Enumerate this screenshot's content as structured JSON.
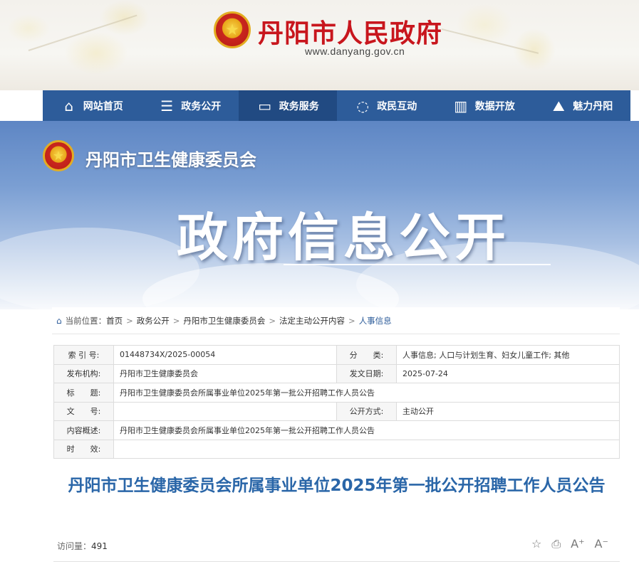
{
  "site": {
    "title": "丹阳市人民政府",
    "url": "www.danyang.gov.cn",
    "emblem_icon": "national-emblem-icon"
  },
  "nav": {
    "items": [
      {
        "label": "网站首页",
        "icon": "home-icon",
        "glyph": "⌂"
      },
      {
        "label": "政务公开",
        "icon": "document-icon",
        "glyph": "☰"
      },
      {
        "label": "政务服务",
        "icon": "monitor-icon",
        "glyph": "▭"
      },
      {
        "label": "政民互动",
        "icon": "chat-icon",
        "glyph": "◌"
      },
      {
        "label": "数据开放",
        "icon": "bar-chart-icon",
        "glyph": "▥"
      },
      {
        "label": "魅力丹阳",
        "icon": "landmark-icon",
        "glyph": "⛰"
      }
    ],
    "active_index": 2
  },
  "hero": {
    "department": "丹阳市卫生健康委员会",
    "title": "政府信息公开"
  },
  "breadcrumb": {
    "prefix": "当前位置：",
    "items": [
      "首页",
      "政务公开",
      "丹阳市卫生健康委员会",
      "法定主动公开内容",
      "人事信息"
    ],
    "separator": ">"
  },
  "meta": {
    "index_label": "索 引 号:",
    "index_value": "01448734X/2025-00054",
    "category_label": "分　　类:",
    "category_value": "人事信息;  人口与计划生育、妇女儿童工作;  其他",
    "issuer_label": "发布机构:",
    "issuer_value": "丹阳市卫生健康委员会",
    "date_label": "发文日期:",
    "date_value": "2025-07-24",
    "title_label": "标　　题:",
    "title_value": "丹阳市卫生健康委员会所属事业单位2025年第一批公开招聘工作人员公告",
    "docno_label": "文　　号:",
    "docno_value": "",
    "mode_label": "公开方式:",
    "mode_value": "主动公开",
    "summary_label": "内容概述:",
    "summary_value": "丹阳市卫生健康委员会所属事业单位2025年第一批公开招聘工作人员公告",
    "validity_label": "时　　效:",
    "validity_value": ""
  },
  "article": {
    "title": "丹阳市卫生健康委员会所属事业单位2025年第一批公开招聘工作人员公告",
    "visits_label": "访问量：",
    "visits_value": "491"
  },
  "tools": {
    "favorite": "☆",
    "print": "⎙",
    "font_larger": "A⁺",
    "font_smaller": "A⁻"
  }
}
